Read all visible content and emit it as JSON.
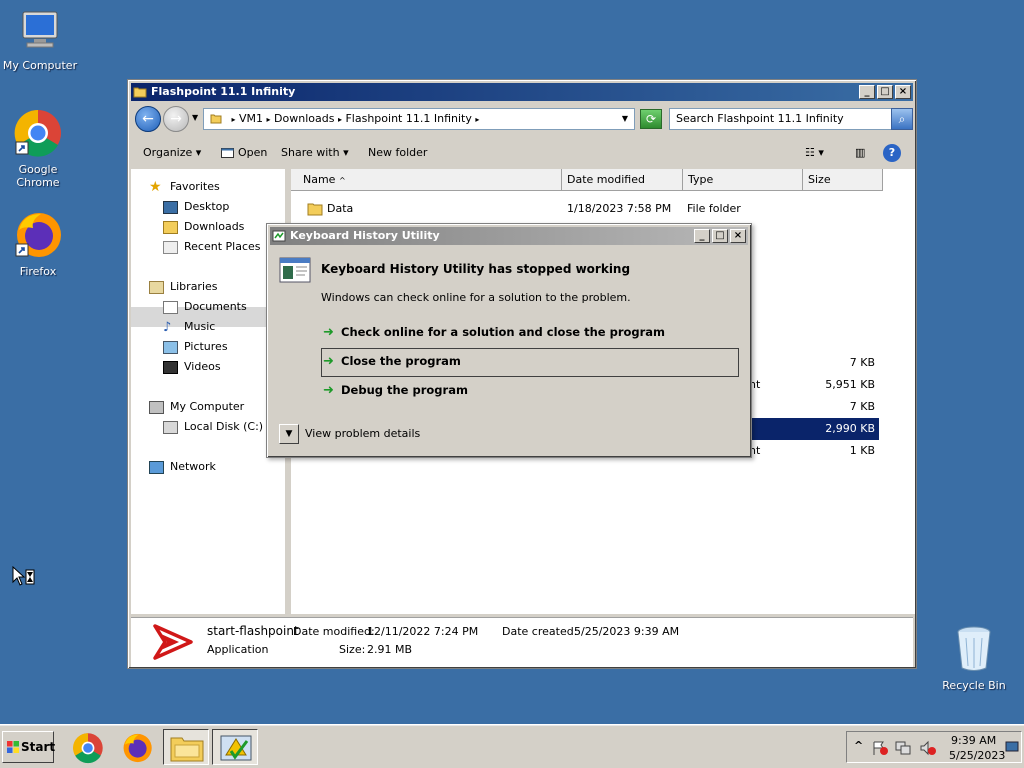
{
  "desktop": {
    "icons": [
      {
        "label": "My Computer"
      },
      {
        "label": "Google Chrome"
      },
      {
        "label": "Firefox"
      },
      {
        "label": "Recycle Bin"
      }
    ]
  },
  "explorer": {
    "title": "Flashpoint 11.1 Infinity",
    "address": [
      "VM1",
      "Downloads",
      "Flashpoint 11.1 Infinity"
    ],
    "search_placeholder": "Search Flashpoint 11.1 Infinity",
    "toolbar": {
      "organize": "Organize",
      "open": "Open",
      "share": "Share with",
      "new_folder": "New folder"
    },
    "nav": {
      "favorites": "Favorites",
      "desktop": "Desktop",
      "downloads": "Downloads",
      "recent": "Recent Places",
      "libraries": "Libraries",
      "documents": "Documents",
      "music": "Music",
      "pictures": "Pictures",
      "videos": "Videos",
      "my_computer": "My Computer",
      "local_disk": "Local Disk (C:)",
      "network": "Network"
    },
    "columns": {
      "name": "Name",
      "date": "Date modified",
      "type": "Type",
      "size": "Size"
    },
    "rows": [
      {
        "name": "Data",
        "date": "1/18/2023 7:58 PM",
        "type": "File folder",
        "size": ""
      },
      {
        "name": "",
        "date": "",
        "type": "",
        "size": "7 KB"
      },
      {
        "name": "",
        "date": "",
        "type": "nt",
        "size": "5,951 KB"
      },
      {
        "name": "",
        "date": "",
        "type": "",
        "size": "7 KB"
      },
      {
        "name": "",
        "date": "",
        "type": "",
        "size": "2,990 KB"
      },
      {
        "name": "",
        "date": "",
        "type": "nt",
        "size": "1 KB"
      }
    ],
    "details": {
      "file_name": "start-flashpoint",
      "file_type": "Application",
      "date_modified_label": "Date modified:",
      "date_modified": "12/11/2022 7:24 PM",
      "date_created_label": "Date created:",
      "date_created": "5/25/2023 9:39 AM",
      "size_label": "Size:",
      "size": "2.91 MB"
    }
  },
  "dialog": {
    "title": "Keyboard History Utility",
    "heading": "Keyboard History Utility has stopped working",
    "message": "Windows can check online for a solution to the problem.",
    "options": [
      "Check online for a solution and close the program",
      "Close the program",
      "Debug the program"
    ],
    "details_toggle": "View problem details"
  },
  "taskbar": {
    "start": "Start",
    "clock_time": "9:39 AM",
    "clock_date": "5/25/2023"
  }
}
